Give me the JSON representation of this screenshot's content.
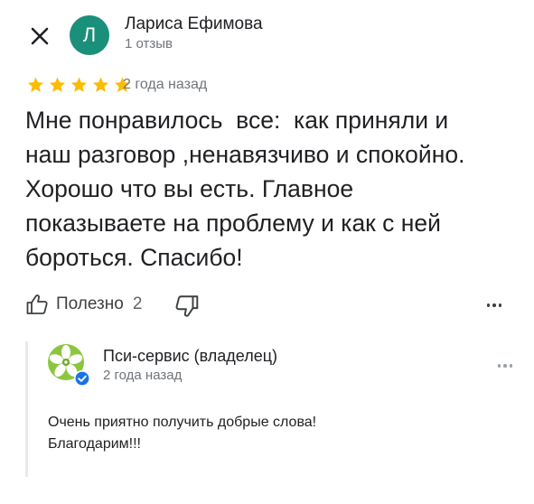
{
  "review": {
    "author_initial": "Л",
    "author_name": "Лариса Ефимова",
    "author_meta": "1 отзыв",
    "rating": 5,
    "date": "2 года назад",
    "text": "Мне понравилось  все:  как приняли и\nнаш разговор ,ненавязчиво и спокойно.\nХорошо что вы есть. Главное\nпоказываете на проблему и как с ней\nбороться. Спасибо!",
    "helpful_label": "Полезно",
    "helpful_count": "2"
  },
  "owner_reply": {
    "name": "Пси-сервис (владелец)",
    "date": "2 года назад",
    "text": "Очень приятно получить добрые слова!\nБлагодарим!!!"
  },
  "colors": {
    "avatar_bg": "#1a8f7a",
    "star": "#fbbc04",
    "verified": "#1a73e8",
    "logo_green": "#8cc63f"
  },
  "icons": [
    "close-icon",
    "star-icon",
    "thumbs-up-icon",
    "thumbs-down-icon",
    "more-icon",
    "verified-icon",
    "flower-logo"
  ]
}
